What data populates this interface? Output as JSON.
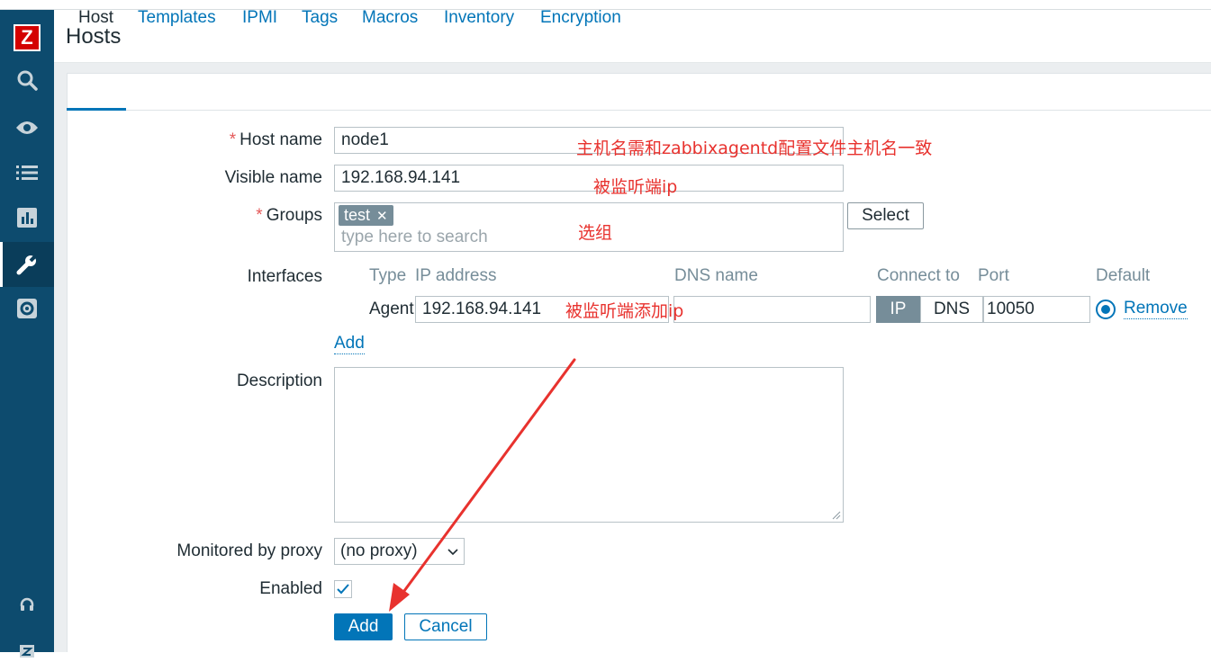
{
  "header": {
    "title": "Hosts"
  },
  "sidebar": {
    "logo": "Z",
    "icons": [
      "search-icon",
      "eye-icon",
      "list-icon",
      "chart-icon",
      "wrench-icon",
      "gear-icon",
      "headset-icon",
      "zabbix-share-icon"
    ]
  },
  "tabs": [
    "Host",
    "Templates",
    "IPMI",
    "Tags",
    "Macros",
    "Inventory",
    "Encryption"
  ],
  "form": {
    "host_name": {
      "label": "Host name",
      "value": "node1"
    },
    "visible_name": {
      "label": "Visible name",
      "value": "192.168.94.141"
    },
    "groups": {
      "label": "Groups",
      "chip": "test",
      "chip_close": "✕",
      "placeholder": "type here to search",
      "select_label": "Select"
    },
    "interfaces": {
      "label": "Interfaces",
      "columns": {
        "type": "Type",
        "ip": "IP address",
        "dns": "DNS name",
        "connect": "Connect to",
        "port": "Port",
        "default": "Default"
      },
      "row": {
        "type": "Agent",
        "ip": "192.168.94.141",
        "dns": "",
        "connect_ip": "IP",
        "connect_dns": "DNS",
        "port": "10050",
        "remove": "Remove"
      },
      "add_label": "Add"
    },
    "description": {
      "label": "Description",
      "value": ""
    },
    "proxy": {
      "label": "Monitored by proxy",
      "value": "(no proxy)"
    },
    "enabled": {
      "label": "Enabled",
      "checked": true
    },
    "required_marker": "*"
  },
  "actions": {
    "add": "Add",
    "cancel": "Cancel"
  },
  "annotations": {
    "host_name_note": "主机名需和zabbixagentd配置文件主机名一致",
    "visible_name_note": "被监听端ip",
    "groups_note": "选组",
    "interface_note": "被监听端添加ip"
  },
  "colors": {
    "sidebar": "#0d4b6e",
    "accent": "#0275b8",
    "annotation": "#e8322e"
  }
}
